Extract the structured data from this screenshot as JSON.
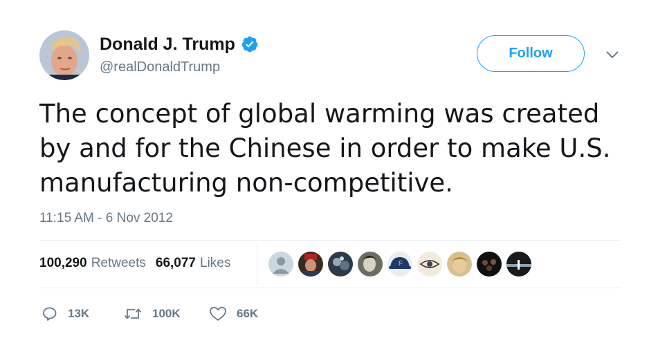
{
  "author": {
    "display_name": "Donald J. Trump",
    "handle": "@realDonaldTrump",
    "verified": true,
    "verified_icon": "verified-badge-icon"
  },
  "header": {
    "follow_label": "Follow",
    "menu_icon": "chevron-down-icon"
  },
  "tweet": {
    "lines": [
      "The concept of global warming was created",
      "by and for the Chinese in order to make U.S.",
      "manufacturing non-competitive."
    ],
    "timestamp": "11:15 AM - 6 Nov 2012"
  },
  "stats": {
    "retweets_count": "100,290",
    "retweets_label": "Retweets",
    "likes_count": "66,077",
    "likes_label": "Likes"
  },
  "actions": {
    "reply_count": "13K",
    "retweet_count": "100K",
    "like_count": "66K"
  },
  "colors": {
    "accent": "#1da1f2",
    "muted": "#657786",
    "text": "#14171a",
    "divider": "#e6ecf0"
  }
}
